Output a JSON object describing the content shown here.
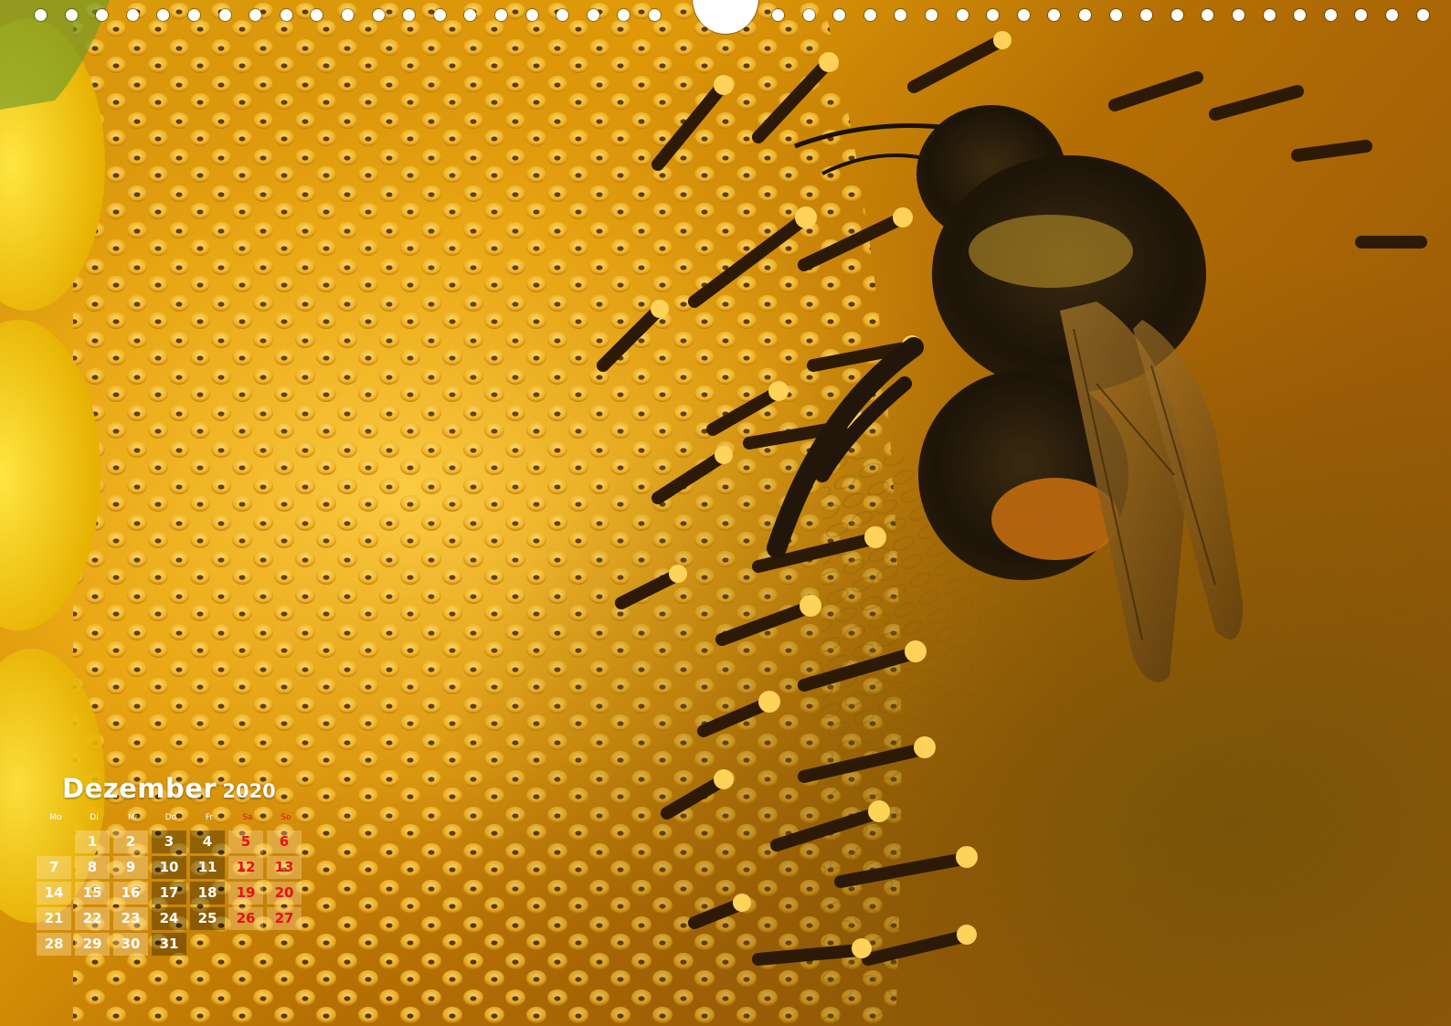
{
  "colors": {
    "accent_weekend": "#e8101b",
    "text_light": "#ffffff",
    "hole": "#ffffff"
  },
  "photo": {
    "subject": "bumblebee-on-sunflower"
  },
  "calendar": {
    "month": "Dezember",
    "year": "2020",
    "weekdays": [
      {
        "label": "Mo",
        "weekend": false
      },
      {
        "label": "Di",
        "weekend": false
      },
      {
        "label": "Mi",
        "weekend": false
      },
      {
        "label": "Do",
        "weekend": false
      },
      {
        "label": "Fr",
        "weekend": false
      },
      {
        "label": "Sa",
        "weekend": true
      },
      {
        "label": "So",
        "weekend": true
      }
    ],
    "first_weekday_index": 1,
    "days_in_month": 31
  }
}
